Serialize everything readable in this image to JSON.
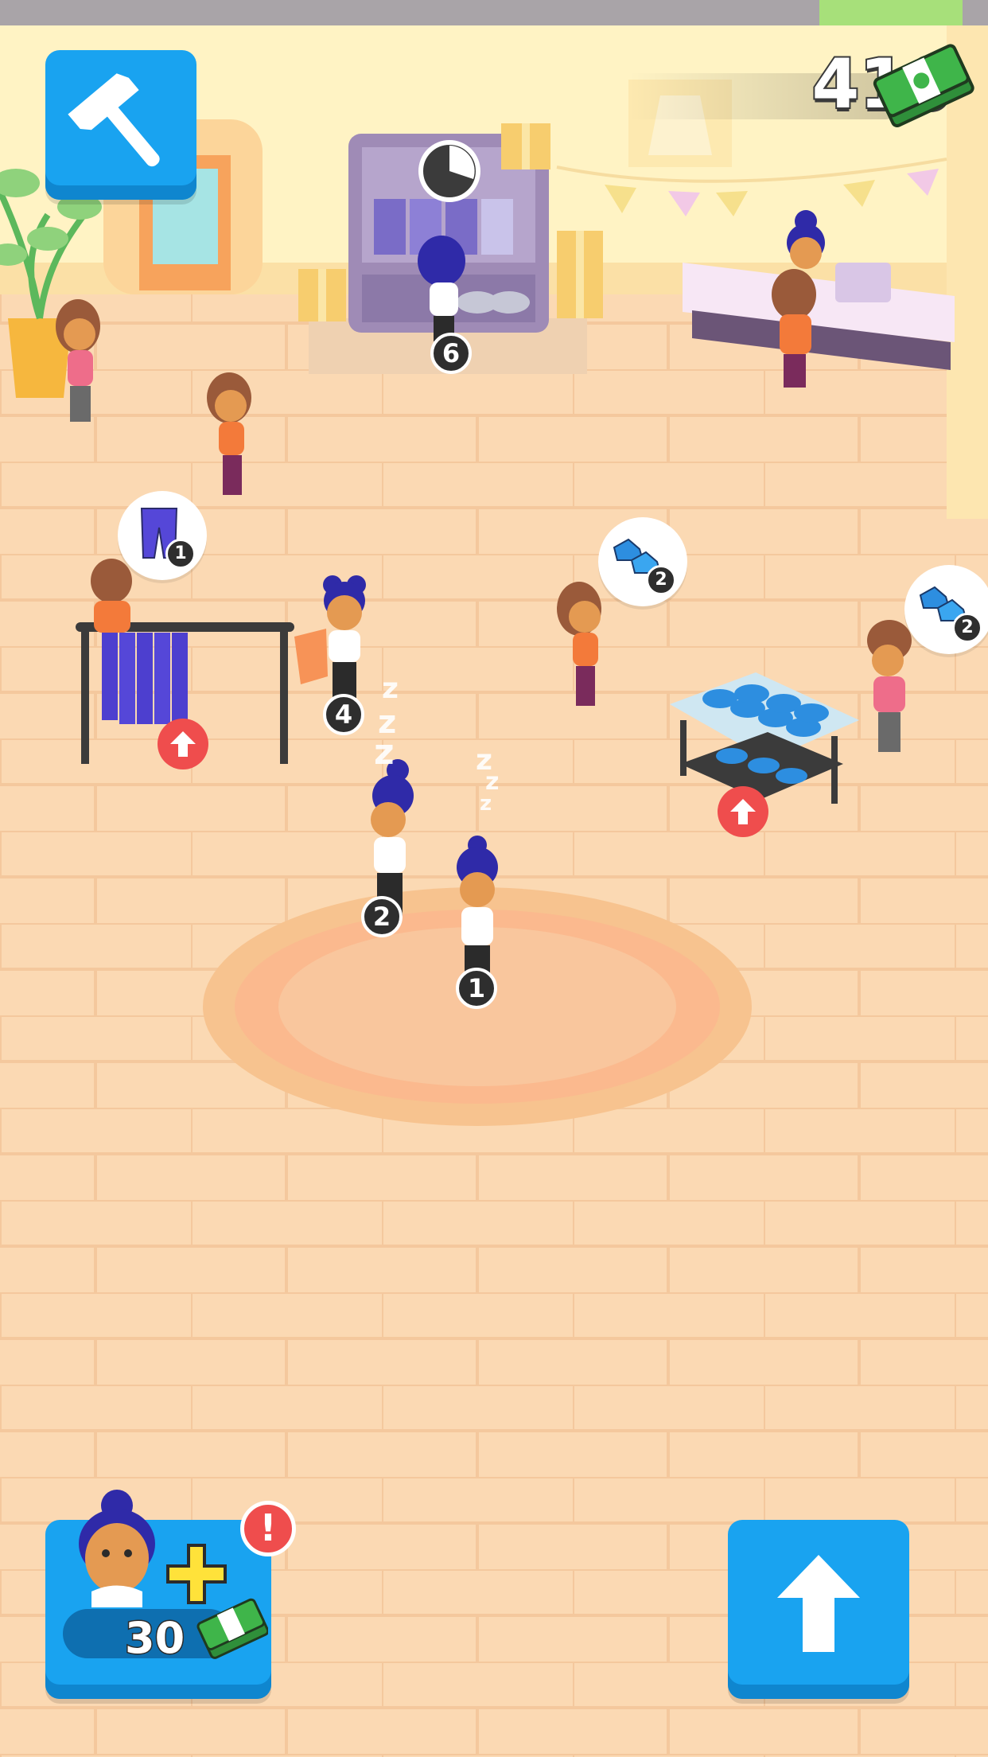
{
  "hud": {
    "cash_value": "410",
    "cash_icon": "cash-stack-icon",
    "build_button_icon": "hammer-icon",
    "hire_button": {
      "cost": "30",
      "icon": "hire-worker-icon",
      "alert": "!"
    },
    "upgrade_button_icon": "up-arrow-icon"
  },
  "workers": [
    {
      "id": "worker-1",
      "number": "1",
      "state": "sleeping"
    },
    {
      "id": "worker-2",
      "number": "2",
      "state": "sleeping"
    },
    {
      "id": "worker-4",
      "number": "4",
      "state": "carrying"
    },
    {
      "id": "worker-6",
      "number": "6",
      "state": "stocking"
    }
  ],
  "customer_requests": [
    {
      "item": "pants-icon",
      "count": "1"
    },
    {
      "item": "sneakers-icon",
      "count": "2"
    },
    {
      "item": "sneakers-icon",
      "count": "2"
    }
  ],
  "colors": {
    "floor": "#fbd9b3",
    "wall": "#fff3c4",
    "button_blue": "#19a3f0",
    "alert_red": "#ef4d4d",
    "cash_green": "#3fb54a",
    "worker_hair": "#2f2aa8"
  }
}
